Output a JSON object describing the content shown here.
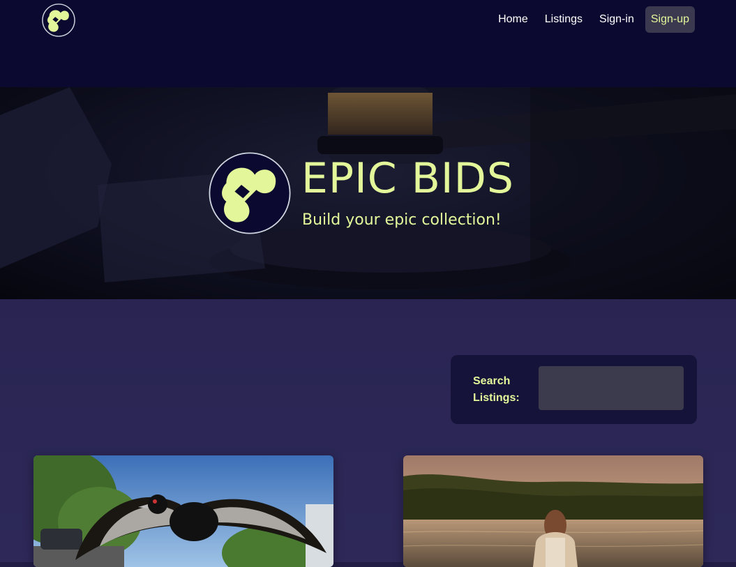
{
  "nav": {
    "logo_icon": "epic-bids-logo-icon",
    "links": [
      {
        "label": "Home"
      },
      {
        "label": "Listings"
      },
      {
        "label": "Sign-in"
      },
      {
        "label": "Sign-up"
      }
    ]
  },
  "hero": {
    "title": "EPIC BIDS",
    "tagline": "Build your epic collection!",
    "background_icon": "gavel-image",
    "logo_icon": "epic-bids-logo-icon"
  },
  "search": {
    "label": "Search Listings:",
    "value": ""
  },
  "listings": [
    {
      "image": "magpie-flying-photo"
    },
    {
      "image": "woman-at-lake-photo"
    }
  ],
  "colors": {
    "accent": "#e3f79a",
    "nav_bg": "#0b0930",
    "page_bg": "#2a2553",
    "panel_bg": "#15133a"
  }
}
